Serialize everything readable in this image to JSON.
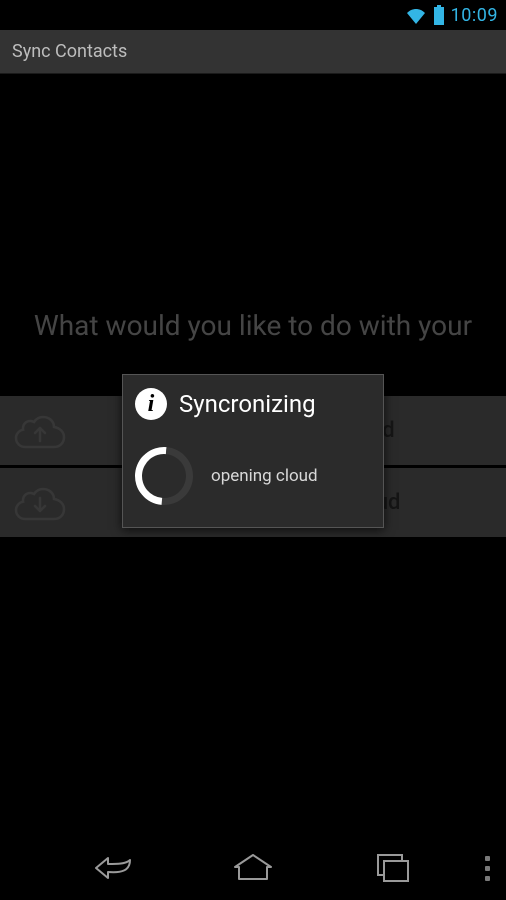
{
  "status_bar": {
    "time": "10:09"
  },
  "action_bar": {
    "title": "Sync Contacts"
  },
  "main": {
    "prompt": "What would you like to do with your",
    "buttons": {
      "send": "Send Contacts to Cloud",
      "get": "Get Contacts from Cloud"
    }
  },
  "dialog": {
    "title": "Syncronizing",
    "message": "opening cloud"
  }
}
